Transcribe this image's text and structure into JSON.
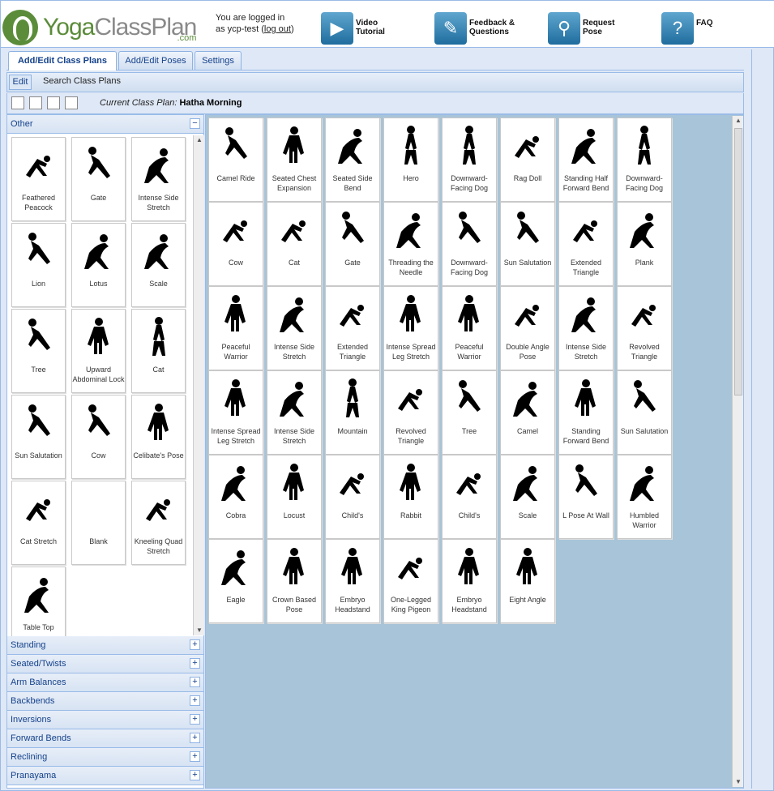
{
  "brand": {
    "logo_text_a": "Yoga",
    "logo_text_b": "ClassPlan",
    "logo_suffix": ".com"
  },
  "login": {
    "line1": "You are logged in",
    "line2": "as ycp-test (",
    "logout": "log out",
    ")": ")"
  },
  "toolbar": [
    {
      "label": "Video Tutorial",
      "icon": "video-icon"
    },
    {
      "label": "Feedback & Questions",
      "icon": "feedback-icon"
    },
    {
      "label": "Request Pose",
      "icon": "pose-icon"
    },
    {
      "label": "FAQ",
      "icon": "question-icon"
    }
  ],
  "tabs": [
    "Add/Edit Class Plans",
    "Add/Edit Poses",
    "Settings"
  ],
  "subtoolbar": {
    "edit": "Edit",
    "search": "Search Class Plans"
  },
  "current_plan": {
    "label": "Current Class Plan:",
    "name": "Hatha Morning"
  },
  "left": {
    "open_section": "Other",
    "poses": [
      "Feathered Peacock",
      "Gate",
      "Intense Side Stretch",
      "Lion",
      "Lotus",
      "Scale",
      "Tree",
      "Upward Abdominal Lock",
      "Cat",
      "Sun Salutation",
      "Cow",
      "Celibate's Pose",
      "Cat Stretch",
      "Blank",
      "Kneeling Quad Stretch",
      "Table Top"
    ],
    "sections": [
      "Standing",
      "Seated/Twists",
      "Arm Balances",
      "Backbends",
      "Inversions",
      "Forward Bends",
      "Reclining",
      "Pranayama"
    ]
  },
  "plan": [
    "Camel Ride",
    "Seated Chest Expansion",
    "Seated Side Bend",
    "Hero",
    "Downward-Facing Dog",
    "Rag Doll",
    "Standing Half Forward Bend",
    "Downward-Facing Dog",
    "Cow",
    "Cat",
    "Gate",
    "Threading the Needle",
    "Downward-Facing Dog",
    "Sun Salutation",
    "Extended Triangle",
    "Plank",
    "Peaceful Warrior",
    "Intense Side Stretch",
    "Extended Triangle",
    "Intense Spread Leg Stretch",
    "Peaceful Warrior",
    "Double Angle Pose",
    "Intense Side Stretch",
    "Revolved Triangle",
    "Intense Spread Leg Stretch",
    "Intense Side Stretch",
    "Mountain",
    "Revolved Triangle",
    "Tree",
    "Camel",
    "Standing Forward Bend",
    "Sun Salutation",
    "Cobra",
    "Locust",
    "Child's",
    "Rabbit",
    "Child's",
    "Scale",
    "L Pose At Wall",
    "Humbled Warrior",
    "Eagle",
    "Crown Based Pose",
    "Embryo Headstand",
    "One-Legged King Pigeon",
    "Embryo Headstand",
    "Eight Angle"
  ]
}
